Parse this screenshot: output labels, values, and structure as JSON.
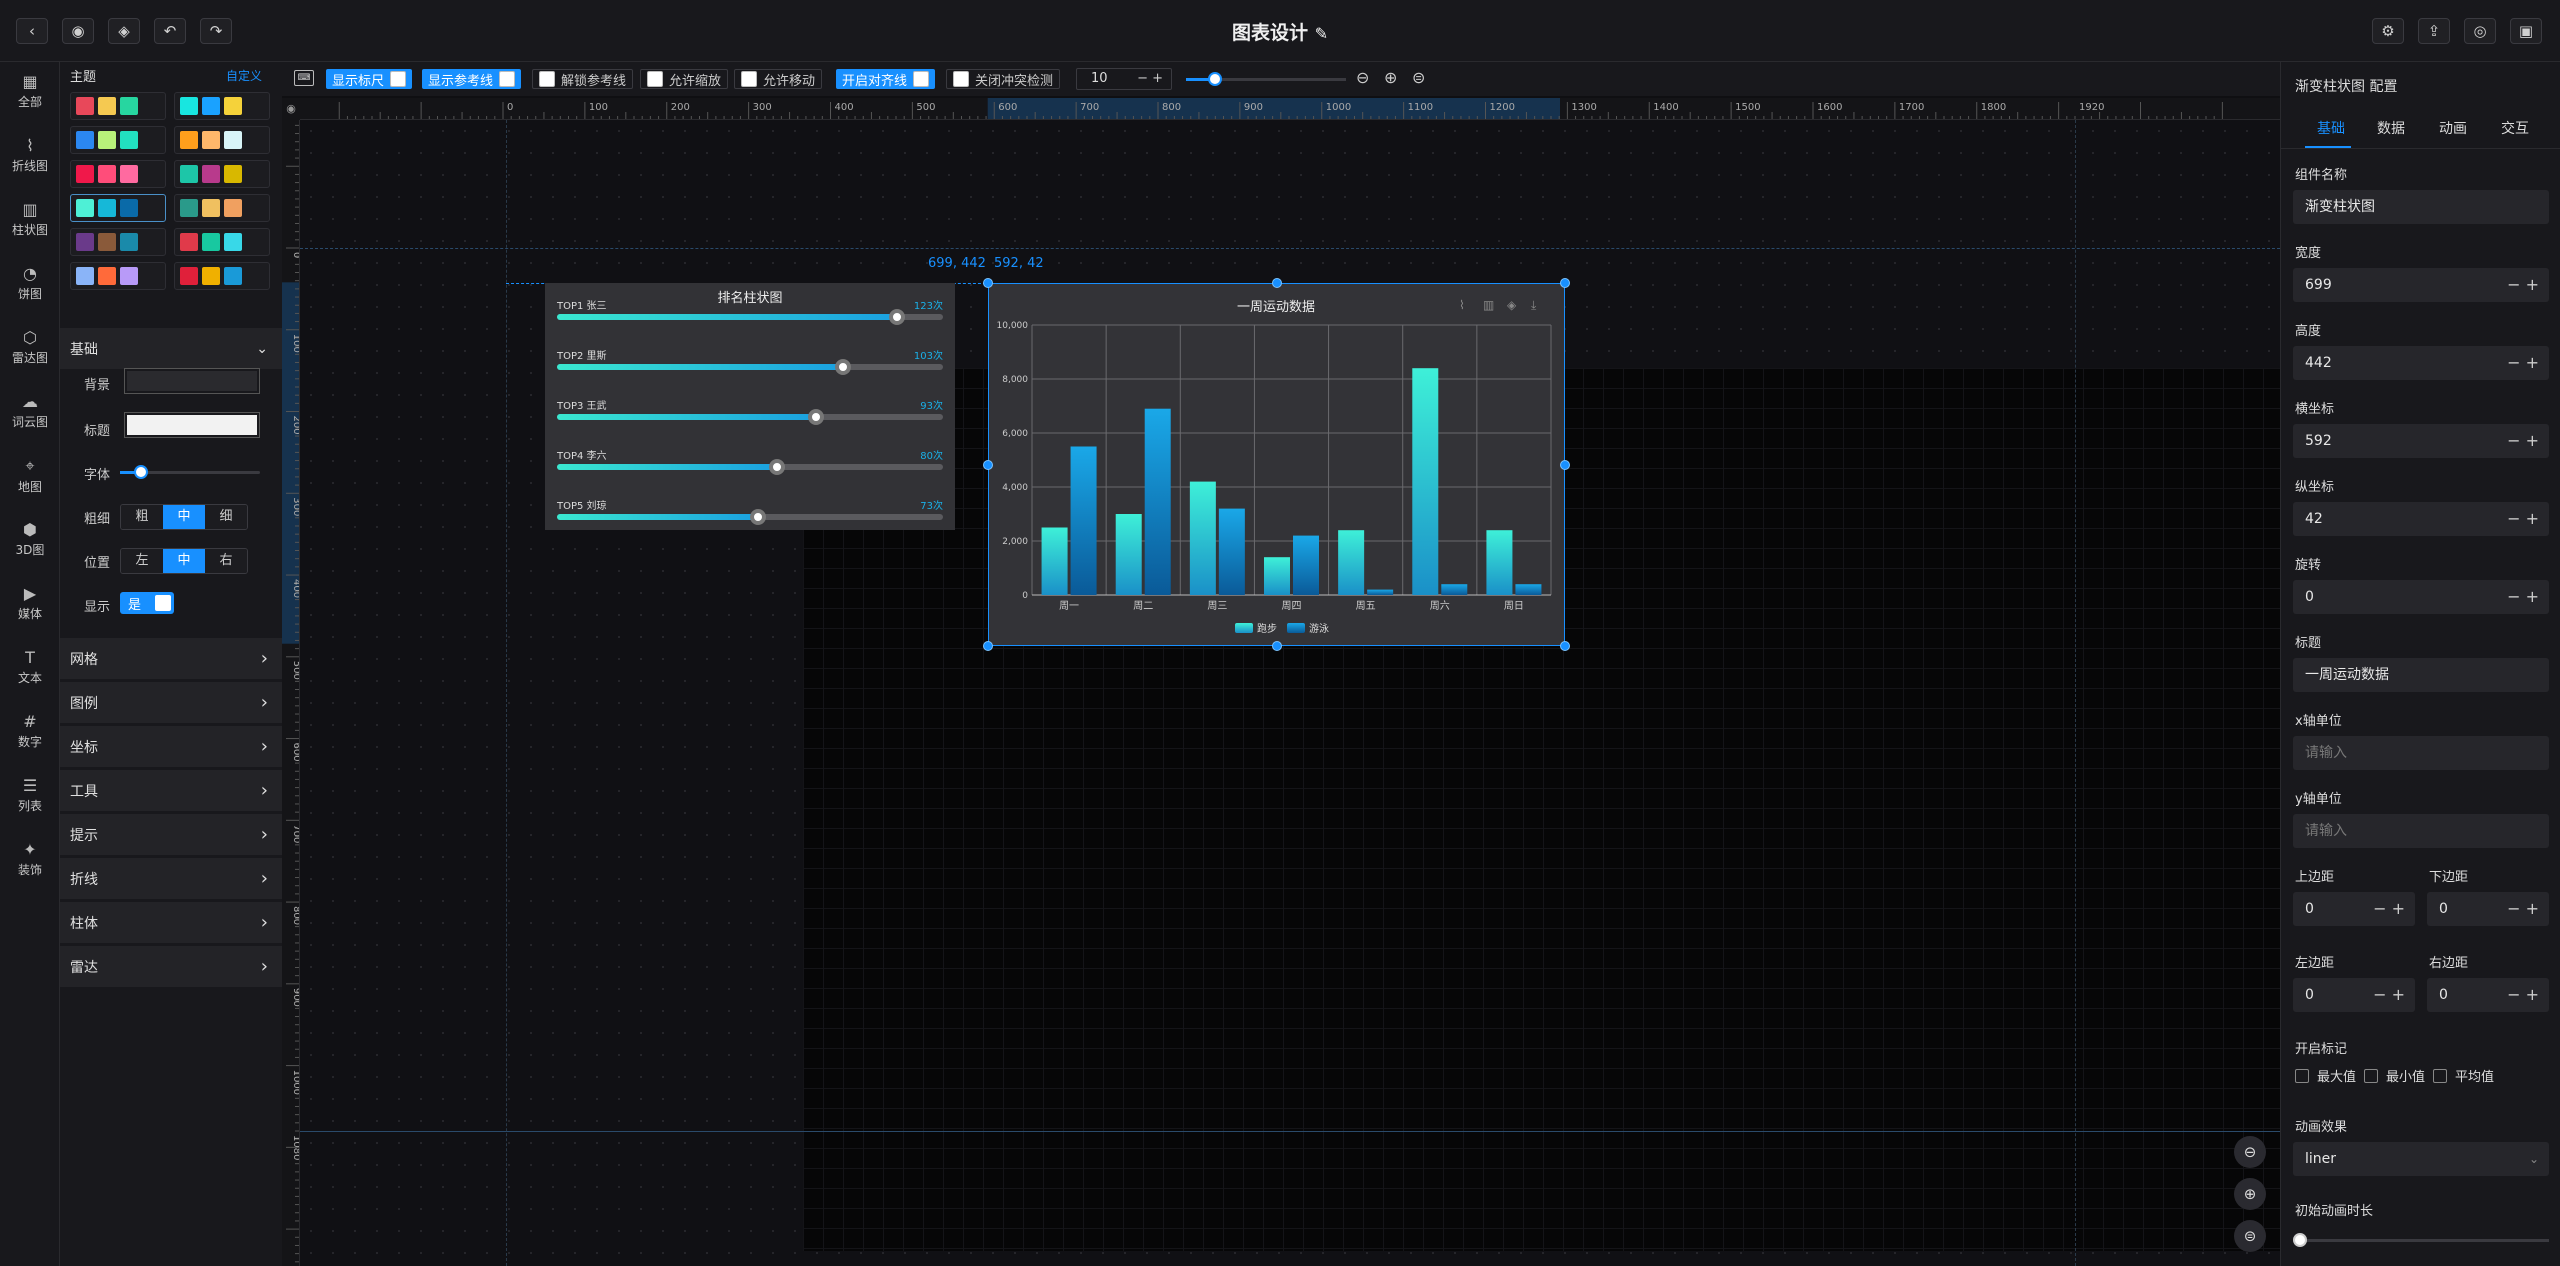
{
  "app": {
    "title": "图表设计"
  },
  "icon_rail": [
    {
      "label": "全部",
      "icon": "grid-icon"
    },
    {
      "label": "折线图",
      "icon": "line-chart-icon"
    },
    {
      "label": "柱状图",
      "icon": "bar-chart-icon"
    },
    {
      "label": "饼图",
      "icon": "pie-chart-icon"
    },
    {
      "label": "雷达图",
      "icon": "radar-icon"
    },
    {
      "label": "词云图",
      "icon": "wordcloud-icon"
    },
    {
      "label": "地图",
      "icon": "map-icon"
    },
    {
      "label": "3D图",
      "icon": "cube-icon"
    },
    {
      "label": "媒体",
      "icon": "media-icon"
    },
    {
      "label": "文本",
      "icon": "text-icon"
    },
    {
      "label": "数字",
      "icon": "number-icon"
    },
    {
      "label": "列表",
      "icon": "list-icon"
    },
    {
      "label": "装饰",
      "icon": "decoration-icon"
    }
  ],
  "left_panel": {
    "theme_title": "主题",
    "custom_link": "自定义",
    "themes": [
      [
        "#e8485a",
        "#f5c951",
        "#27d6a0"
      ],
      [
        "#18e6e0",
        "#1aa2ff",
        "#f5d23a"
      ],
      [
        "#2b87f0",
        "#b8f27a",
        "#22e0c0"
      ],
      [
        "#ff9f1c",
        "#ffb86b",
        "#d8f4f8"
      ],
      [
        "#f0184a",
        "#ff4d7a",
        "#ff6aa0"
      ],
      [
        "#1dc6a8",
        "#b83a8c",
        "#d8b800"
      ],
      [
        "#4ef0d6",
        "#16b8d8",
        "#0a6aa8"
      ],
      [
        "#2a9a8a",
        "#f0c060",
        "#f0a060"
      ],
      [
        "#6a3a8a",
        "#8a5a3a",
        "#1a8aaa"
      ],
      [
        "#e03a4a",
        "#18c8a0",
        "#38d8e8"
      ],
      [
        "#8ab4f8",
        "#ff6a3a",
        "#b89af8"
      ],
      [
        "#e0203a",
        "#f0b000",
        "#1a9ad8"
      ]
    ],
    "basic_title": "基础",
    "bg_label": "背景",
    "title_label": "标题",
    "font_label": "字体",
    "weight_label": "粗细",
    "weight_options": [
      "粗",
      "中",
      "细"
    ],
    "position_label": "位置",
    "position_options": [
      "左",
      "中",
      "右"
    ],
    "show_label": "显示",
    "show_value": "是",
    "sections": [
      "网格",
      "图例",
      "坐标",
      "工具",
      "提示",
      "折线",
      "柱体",
      "雷达"
    ],
    "colors": {
      "bg": "#2a2a2e",
      "title": "#f2f2f2"
    }
  },
  "toolbar": {
    "show_ruler": "显示标尺",
    "show_guides": "显示参考线",
    "unlock_guides": "解锁参考线",
    "allow_zoom": "允许缩放",
    "allow_move": "允许移动",
    "align_lines": "开启对齐线",
    "collision": "关闭冲突检测",
    "grid_value": "10"
  },
  "ruler": {
    "h_ticks": [
      "0",
      "100",
      "200",
      "300",
      "400",
      "500",
      "600",
      "700",
      "800",
      "900",
      "1000",
      "1100",
      "1200",
      "1300",
      "1400",
      "1500",
      "1600",
      "1700",
      "1800",
      "1920"
    ],
    "v_ticks": [
      "0",
      "100",
      "200",
      "300",
      "400",
      "500",
      "600",
      "700",
      "800",
      "900",
      "1000",
      "1080"
    ]
  },
  "canvas": {
    "readout_size": "699, 442",
    "readout_pos": "592, 42"
  },
  "rank_widget": {
    "title": "排名柱状图",
    "items": [
      {
        "label": "TOP1 张三",
        "value": "123次",
        "ratio": 0.88
      },
      {
        "label": "TOP2 里斯",
        "value": "103次",
        "ratio": 0.74
      },
      {
        "label": "TOP3 王武",
        "value": "93次",
        "ratio": 0.67
      },
      {
        "label": "TOP4 李六",
        "value": "80次",
        "ratio": 0.57
      },
      {
        "label": "TOP5 刘琼",
        "value": "73次",
        "ratio": 0.52
      }
    ]
  },
  "chart_data": {
    "type": "bar",
    "title": "一周运动数据",
    "categories": [
      "周一",
      "周二",
      "周三",
      "周四",
      "周五",
      "周六",
      "周日"
    ],
    "series": [
      {
        "name": "跑步",
        "values": [
          2500,
          3000,
          4200,
          1400,
          2400,
          8400,
          2400
        ]
      },
      {
        "name": "游泳",
        "values": [
          5500,
          6900,
          3200,
          2200,
          200,
          400,
          400
        ]
      }
    ],
    "ylim": [
      0,
      10000
    ],
    "yticks": [
      "0",
      "2,000",
      "4,000",
      "6,000",
      "8,000",
      "10,000"
    ],
    "grid": true,
    "legend": "bottom"
  },
  "right_panel": {
    "header": "渐变柱状图 配置",
    "tabs": [
      "基础",
      "数据",
      "动画",
      "交互"
    ],
    "name_label": "组件名称",
    "name_value": "渐变柱状图",
    "width_label": "宽度",
    "width_value": "699",
    "height_label": "高度",
    "height_value": "442",
    "x_label": "横坐标",
    "x_value": "592",
    "y_label": "纵坐标",
    "y_value": "42",
    "rotate_label": "旋转",
    "rotate_value": "0",
    "title_label": "标题",
    "title_value": "一周运动数据",
    "xunit_label": "x轴单位",
    "yunit_label": "y轴单位",
    "placeholder": "请输入",
    "top_label": "上边距",
    "top_value": "0",
    "bottom_label": "下边距",
    "bottom_value": "0",
    "left_label": "左边距",
    "left_value": "0",
    "right_label": "右边距",
    "right_value": "0",
    "mark_label": "开启标记",
    "mark_max": "最大值",
    "mark_min": "最小值",
    "mark_avg": "平均值",
    "anim_label": "动画效果",
    "anim_value": "liner",
    "duration_label": "初始动画时长"
  }
}
